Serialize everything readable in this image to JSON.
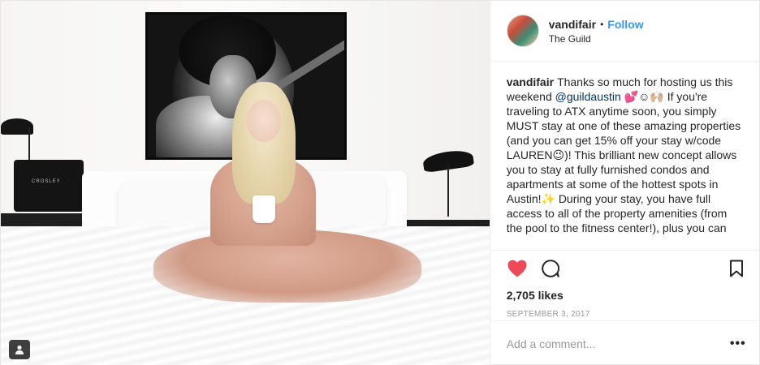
{
  "post": {
    "media_badge_icon": "multiple-photos-icon"
  },
  "photo": {
    "recordplayer_brand": "CROSLEY"
  },
  "header": {
    "username": "vandifair",
    "separator": "•",
    "follow_label": "Follow",
    "location": "The Guild"
  },
  "caption": {
    "username": "vandifair",
    "text_before_mention": "Thanks so much for hosting us this weekend ",
    "mention": "@guildaustin",
    "text_after_mention": " 💕☺🙌🏼 If you're traveling to ATX anytime soon, you simply MUST stay at one of these amazing properties (and you can get 15% off your stay w/code LAUREN😉)! This brilliant new concept allows you to stay at fully furnished condos and apartments at some of the hottest spots in Austin!✨ During your stay, you have full access to all of the property amenities (from the pool to the fitness center!), plus you can"
  },
  "actions": {
    "like_icon": "heart-icon",
    "like_color": "#ed4956",
    "comment_icon": "comment-icon",
    "save_icon": "bookmark-icon"
  },
  "likes": "2,705 likes",
  "date": "SEPTEMBER 3, 2017",
  "comment_box": {
    "placeholder": "Add a comment...",
    "more_label": "•••"
  }
}
